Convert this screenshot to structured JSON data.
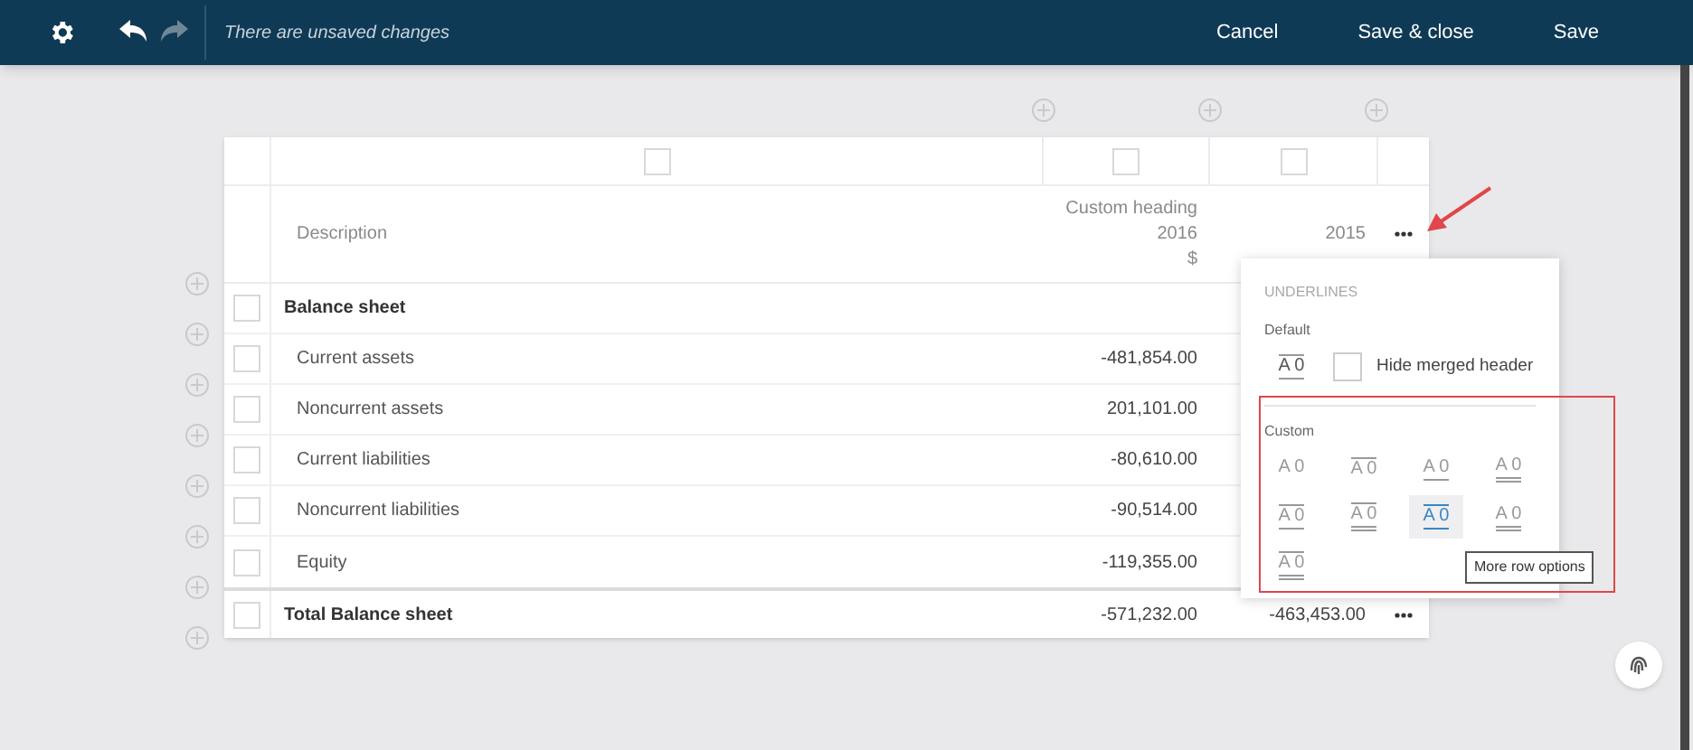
{
  "toolbar": {
    "undo_enabled": true,
    "redo_enabled": false,
    "status": "There are unsaved changes",
    "actions": [
      "Cancel",
      "Save & close",
      "Save"
    ]
  },
  "table": {
    "columns": [
      {
        "lines": [
          "Description"
        ],
        "checked": false
      },
      {
        "lines": [
          "Custom heading",
          "2016",
          "$"
        ],
        "checked": false
      },
      {
        "lines": [
          "2015"
        ],
        "checked": false
      }
    ],
    "rows": [
      {
        "kind": "section",
        "label": "Balance sheet",
        "values": [],
        "checked": false
      },
      {
        "kind": "item",
        "label": "Current assets",
        "values": [
          "-481,854.00"
        ],
        "checked": false
      },
      {
        "kind": "item",
        "label": "Noncurrent assets",
        "values": [
          "201,101.00"
        ],
        "checked": false
      },
      {
        "kind": "item",
        "label": "Current liabilities",
        "values": [
          "-80,610.00"
        ],
        "checked": false
      },
      {
        "kind": "item",
        "label": "Noncurrent liabilities",
        "values": [
          "-90,514.00"
        ],
        "checked": false
      },
      {
        "kind": "item",
        "label": "Equity",
        "values": [
          "-119,355.00"
        ],
        "checked": false
      },
      {
        "kind": "total",
        "label": "Total Balance sheet",
        "values": [
          "-571,232.00",
          "-463,453.00"
        ],
        "checked": false
      }
    ]
  },
  "popup": {
    "title": "UNDERLINES",
    "default_label": "Default",
    "default_option": {
      "kind": "top-bottom",
      "text": "A 0"
    },
    "hide_merged_header": {
      "label": "Hide merged header",
      "checked": false
    },
    "custom_label": "Custom",
    "options": [
      {
        "kind": "none",
        "text": "A 0",
        "selected": false
      },
      {
        "kind": "top",
        "text": "A 0",
        "selected": false
      },
      {
        "kind": "bottom",
        "text": "A 0",
        "selected": false
      },
      {
        "kind": "double-bottom",
        "text": "A 0",
        "selected": false
      },
      {
        "kind": "top-bottom",
        "text": "A 0",
        "selected": false
      },
      {
        "kind": "top-double-bottom",
        "text": "A 0",
        "selected": false
      },
      {
        "kind": "top-bottom",
        "text": "A 0",
        "selected": true
      },
      {
        "kind": "double-bottom",
        "text": "A 0",
        "selected": false
      },
      {
        "kind": "top-double-bottom",
        "text": "A 0",
        "selected": false
      }
    ],
    "tooltip": "More row options"
  }
}
